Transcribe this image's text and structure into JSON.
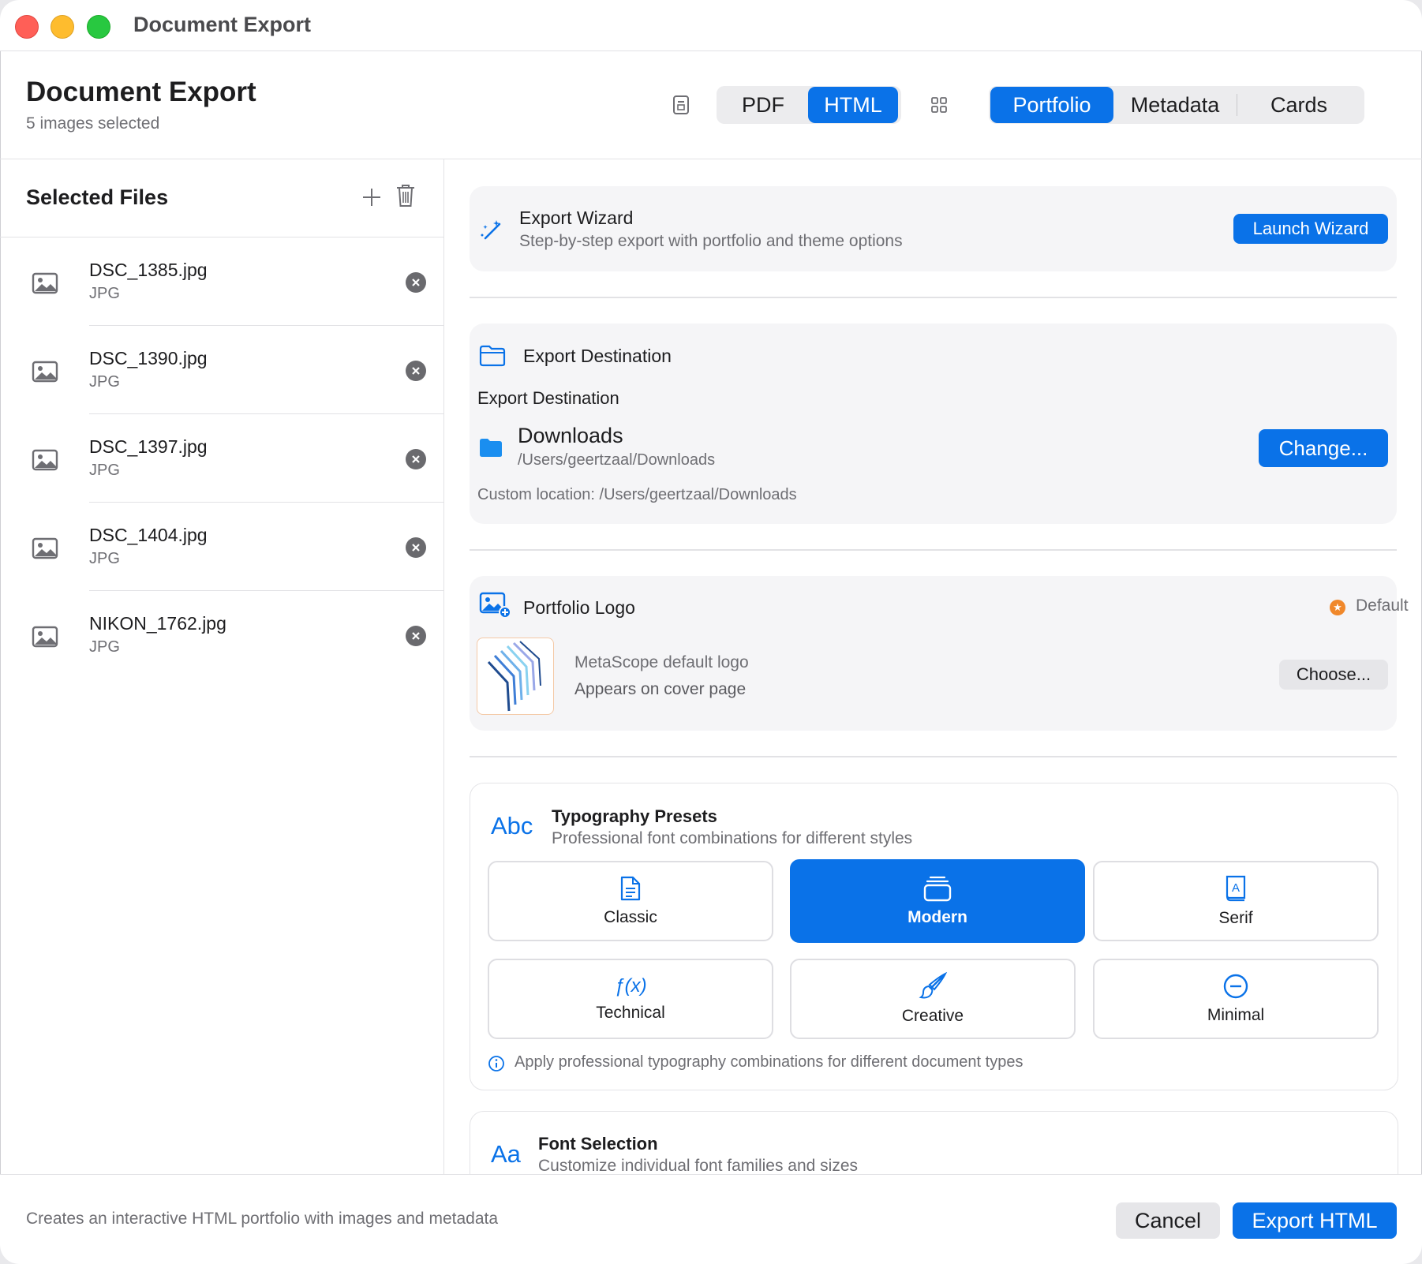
{
  "window": {
    "title": "Document Export"
  },
  "header": {
    "title": "Document Export",
    "subtitle": "5 images selected",
    "format_tabs": [
      "PDF",
      "HTML"
    ],
    "format_selected": "HTML",
    "view_tabs": [
      "Portfolio",
      "Metadata",
      "Cards"
    ],
    "view_selected": "Portfolio"
  },
  "sidebar": {
    "title": "Selected Files",
    "files": [
      {
        "name": "DSC_1385.jpg",
        "type": "JPG"
      },
      {
        "name": "DSC_1390.jpg",
        "type": "JPG"
      },
      {
        "name": "DSC_1397.jpg",
        "type": "JPG"
      },
      {
        "name": "DSC_1404.jpg",
        "type": "JPG"
      },
      {
        "name": "NIKON_1762.jpg",
        "type": "JPG"
      }
    ]
  },
  "wizard": {
    "title": "Export Wizard",
    "subtitle": "Step-by-step export with portfolio and theme options",
    "button": "Launch Wizard"
  },
  "destination": {
    "section_title": "Export Destination",
    "label": "Export Destination",
    "folder_name": "Downloads",
    "folder_path": "/Users/geertzaal/Downloads",
    "change_button": "Change...",
    "custom_location": "Custom location: /Users/geertzaal/Downloads"
  },
  "logo": {
    "section_title": "Portfolio Logo",
    "badge": "Default",
    "line1": "MetaScope default logo",
    "line2": "Appears on cover page",
    "choose_button": "Choose..."
  },
  "typography": {
    "icon_text": "Abc",
    "title": "Typography Presets",
    "subtitle": "Professional font combinations for different styles",
    "presets": [
      "Classic",
      "Modern",
      "Serif",
      "Technical",
      "Creative",
      "Minimal"
    ],
    "selected": "Modern",
    "technical_icon_text": "ƒ(x)",
    "info": "Apply professional typography combinations for different document types"
  },
  "fonts": {
    "icon_text": "Aa",
    "title": "Font Selection",
    "subtitle": "Customize individual font families and sizes"
  },
  "footer": {
    "description": "Creates an interactive HTML portfolio with images and metadata",
    "cancel": "Cancel",
    "export": "Export HTML"
  },
  "colors": {
    "accent": "#0a72e8",
    "badge": "#f0882b"
  }
}
